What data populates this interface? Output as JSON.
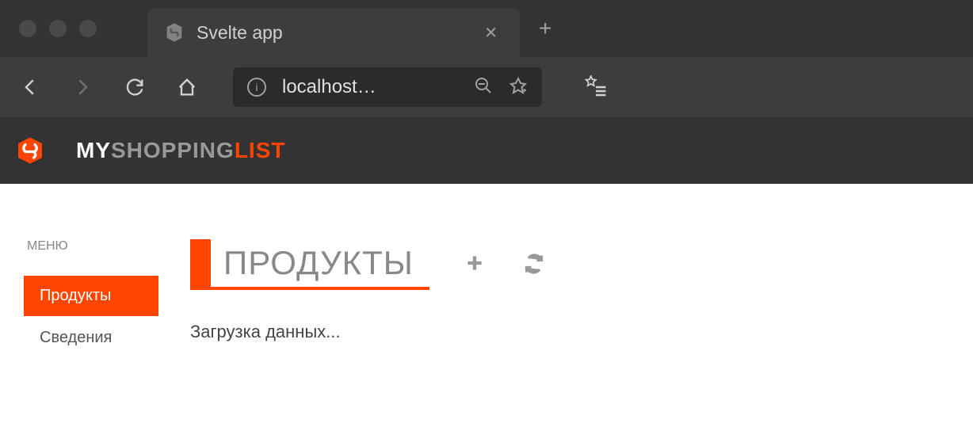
{
  "browser": {
    "tab_title": "Svelte app",
    "address": "localhost…"
  },
  "app_header": {
    "title_part1": "MY",
    "title_part2": "SHOPPING",
    "title_part3": "LIST"
  },
  "sidebar": {
    "label": "МЕНЮ",
    "items": [
      {
        "label": "Продукты",
        "active": true
      },
      {
        "label": "Сведения",
        "active": false
      }
    ]
  },
  "content": {
    "page_title": "ПРОДУКТЫ",
    "loading_text": "Загрузка данных..."
  }
}
